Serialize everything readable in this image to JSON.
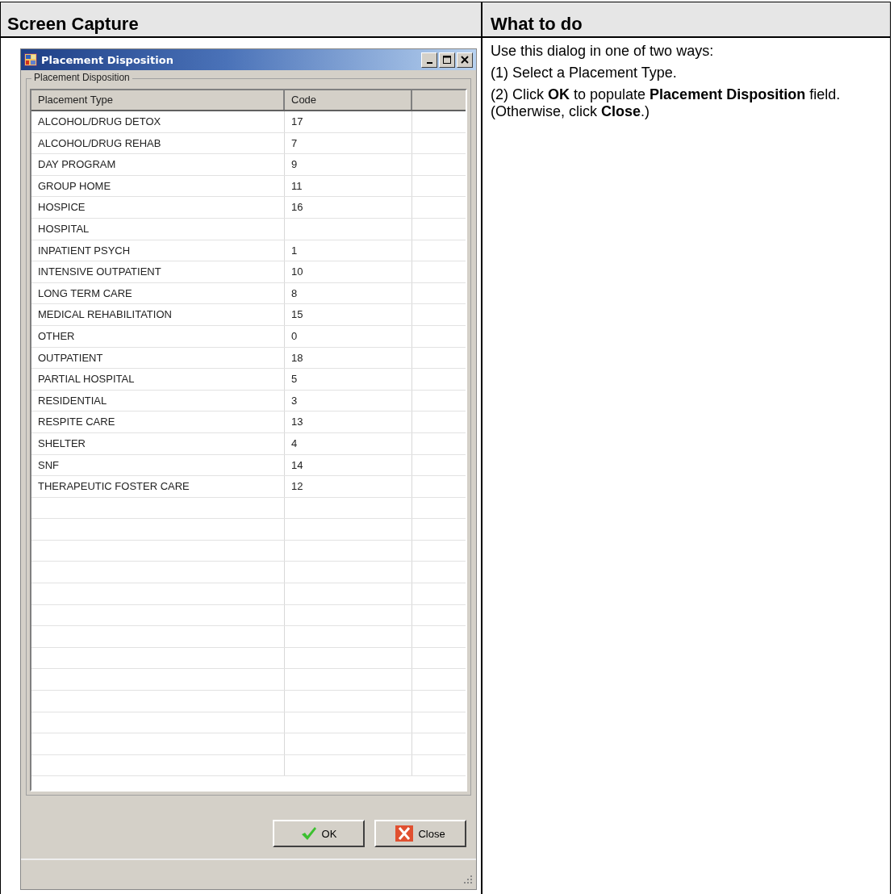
{
  "document": {
    "columns": [
      "Screen Capture",
      "What to do"
    ]
  },
  "dialog": {
    "title": "Placement Disposition",
    "group_label": "Placement Disposition",
    "table": {
      "columns": [
        "Placement Type",
        "Code"
      ],
      "rows": [
        {
          "placement_type": "ALCOHOL/DRUG DETOX",
          "code": "17"
        },
        {
          "placement_type": "ALCOHOL/DRUG REHAB",
          "code": "7"
        },
        {
          "placement_type": "DAY PROGRAM",
          "code": "9"
        },
        {
          "placement_type": "GROUP HOME",
          "code": "11"
        },
        {
          "placement_type": "HOSPICE",
          "code": "16"
        },
        {
          "placement_type": "HOSPITAL"
        },
        {
          "placement_type": "INPATIENT PSYCH",
          "code": "1"
        },
        {
          "placement_type": "INTENSIVE OUTPATIENT",
          "code": "10"
        },
        {
          "placement_type": "LONG TERM CARE",
          "code": "8"
        },
        {
          "placement_type": "MEDICAL REHABILITATION",
          "code": "15"
        },
        {
          "placement_type": "OTHER",
          "code": "0"
        },
        {
          "placement_type": "OUTPATIENT",
          "code": "18"
        },
        {
          "placement_type": "PARTIAL HOSPITAL",
          "code": "5"
        },
        {
          "placement_type": "RESIDENTIAL",
          "code": "3"
        },
        {
          "placement_type": "RESPITE CARE",
          "code": "13"
        },
        {
          "placement_type": "SHELTER",
          "code": "4"
        },
        {
          "placement_type": "SNF",
          "code": "14"
        },
        {
          "placement_type": "THERAPEUTIC FOSTER CARE",
          "code": "12"
        }
      ]
    },
    "buttons": [
      {
        "label": "OK",
        "kind": "ok"
      },
      {
        "label": "Close",
        "kind": "close"
      }
    ]
  },
  "instructions": [
    "Use this dialog in one of two ways:",
    "(1) Select a Placement Type.",
    "(2) Click **OK** to populate **Placement Disposition** field. (Otherwise, click **Close**.)"
  ]
}
